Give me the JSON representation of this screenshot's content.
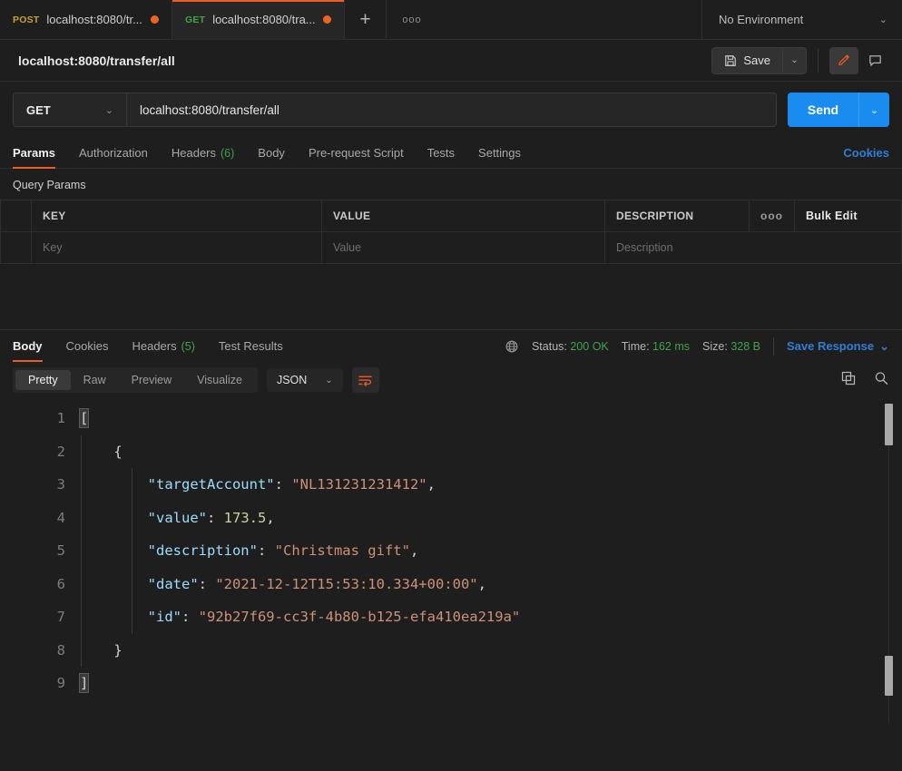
{
  "tabs": [
    {
      "method": "POST",
      "name": "localhost:8080/tr...",
      "active": false
    },
    {
      "method": "GET",
      "name": "localhost:8080/tra...",
      "active": true
    }
  ],
  "tabbar": {
    "new_tab": "+",
    "more": "ooo",
    "environment": "No Environment",
    "chevron": "⌄"
  },
  "request": {
    "title": "localhost:8080/transfer/all",
    "save_label": "Save",
    "save_caret": "⌄",
    "method": "GET",
    "method_caret": "⌄",
    "url": "localhost:8080/transfer/all",
    "send_label": "Send",
    "send_caret": "⌄"
  },
  "request_tabs": [
    {
      "label": "Params",
      "count": "",
      "active": true
    },
    {
      "label": "Authorization",
      "count": "",
      "active": false
    },
    {
      "label": "Headers",
      "count": "(6)",
      "active": false
    },
    {
      "label": "Body",
      "count": "",
      "active": false
    },
    {
      "label": "Pre-request Script",
      "count": "",
      "active": false
    },
    {
      "label": "Tests",
      "count": "",
      "active": false
    },
    {
      "label": "Settings",
      "count": "",
      "active": false
    }
  ],
  "cookies_link": "Cookies",
  "query_params": {
    "title": "Query Params",
    "headers": [
      "KEY",
      "VALUE",
      "DESCRIPTION"
    ],
    "more_dots": "ooo",
    "bulk_edit": "Bulk Edit",
    "row_placeholders": [
      "Key",
      "Value",
      "Description"
    ]
  },
  "response_tabs": [
    {
      "label": "Body",
      "count": "",
      "active": true
    },
    {
      "label": "Cookies",
      "count": "",
      "active": false
    },
    {
      "label": "Headers",
      "count": "(5)",
      "active": false
    },
    {
      "label": "Test Results",
      "count": "",
      "active": false
    }
  ],
  "response_meta": {
    "status_label": "Status:",
    "status_value": "200 OK",
    "time_label": "Time:",
    "time_value": "162 ms",
    "size_label": "Size:",
    "size_value": "328 B",
    "save_response": "Save Response",
    "save_response_caret": "⌄"
  },
  "body_toolbar": {
    "views": [
      {
        "label": "Pretty",
        "active": true
      },
      {
        "label": "Raw",
        "active": false
      },
      {
        "label": "Preview",
        "active": false
      },
      {
        "label": "Visualize",
        "active": false
      }
    ],
    "format": "JSON",
    "format_caret": "⌄"
  },
  "code": {
    "lines": [
      {
        "n": "1",
        "indent": 0,
        "tokens": [
          {
            "t": "[",
            "c": "brk"
          }
        ]
      },
      {
        "n": "2",
        "indent": 1,
        "tokens": [
          {
            "t": "{",
            "c": "punct"
          }
        ]
      },
      {
        "n": "3",
        "indent": 2,
        "tokens": [
          {
            "t": "\"targetAccount\"",
            "c": "key"
          },
          {
            "t": ": ",
            "c": "punct"
          },
          {
            "t": "\"NL131231231412\"",
            "c": "str"
          },
          {
            "t": ",",
            "c": "punct"
          }
        ]
      },
      {
        "n": "4",
        "indent": 2,
        "tokens": [
          {
            "t": "\"value\"",
            "c": "key"
          },
          {
            "t": ": ",
            "c": "punct"
          },
          {
            "t": "173.5",
            "c": "num"
          },
          {
            "t": ",",
            "c": "punct"
          }
        ]
      },
      {
        "n": "5",
        "indent": 2,
        "tokens": [
          {
            "t": "\"description\"",
            "c": "key"
          },
          {
            "t": ": ",
            "c": "punct"
          },
          {
            "t": "\"Christmas gift\"",
            "c": "str"
          },
          {
            "t": ",",
            "c": "punct"
          }
        ]
      },
      {
        "n": "6",
        "indent": 2,
        "tokens": [
          {
            "t": "\"date\"",
            "c": "key"
          },
          {
            "t": ": ",
            "c": "punct"
          },
          {
            "t": "\"2021-12-12T15:53:10.334+00:00\"",
            "c": "str"
          },
          {
            "t": ",",
            "c": "punct"
          }
        ]
      },
      {
        "n": "7",
        "indent": 2,
        "tokens": [
          {
            "t": "\"id\"",
            "c": "key"
          },
          {
            "t": ": ",
            "c": "punct"
          },
          {
            "t": "\"92b27f69-cc3f-4b80-b125-efa410ea219a\"",
            "c": "str"
          }
        ]
      },
      {
        "n": "8",
        "indent": 1,
        "tokens": [
          {
            "t": "}",
            "c": "punct"
          }
        ]
      },
      {
        "n": "9",
        "indent": 0,
        "tokens": [
          {
            "t": "]",
            "c": "brk"
          }
        ]
      }
    ]
  },
  "colors": {
    "accent_orange": "#ef5b25",
    "send_blue": "#1a8cf0",
    "link_blue": "#2e7fd5",
    "status_green": "#3fa34a",
    "get_green": "#3fa34a",
    "post_yellow": "#c5a135",
    "dirty_dot": "#f06321",
    "json_key": "#9cdcfe",
    "json_string": "#ce9178",
    "json_number": "#c7d49a"
  }
}
